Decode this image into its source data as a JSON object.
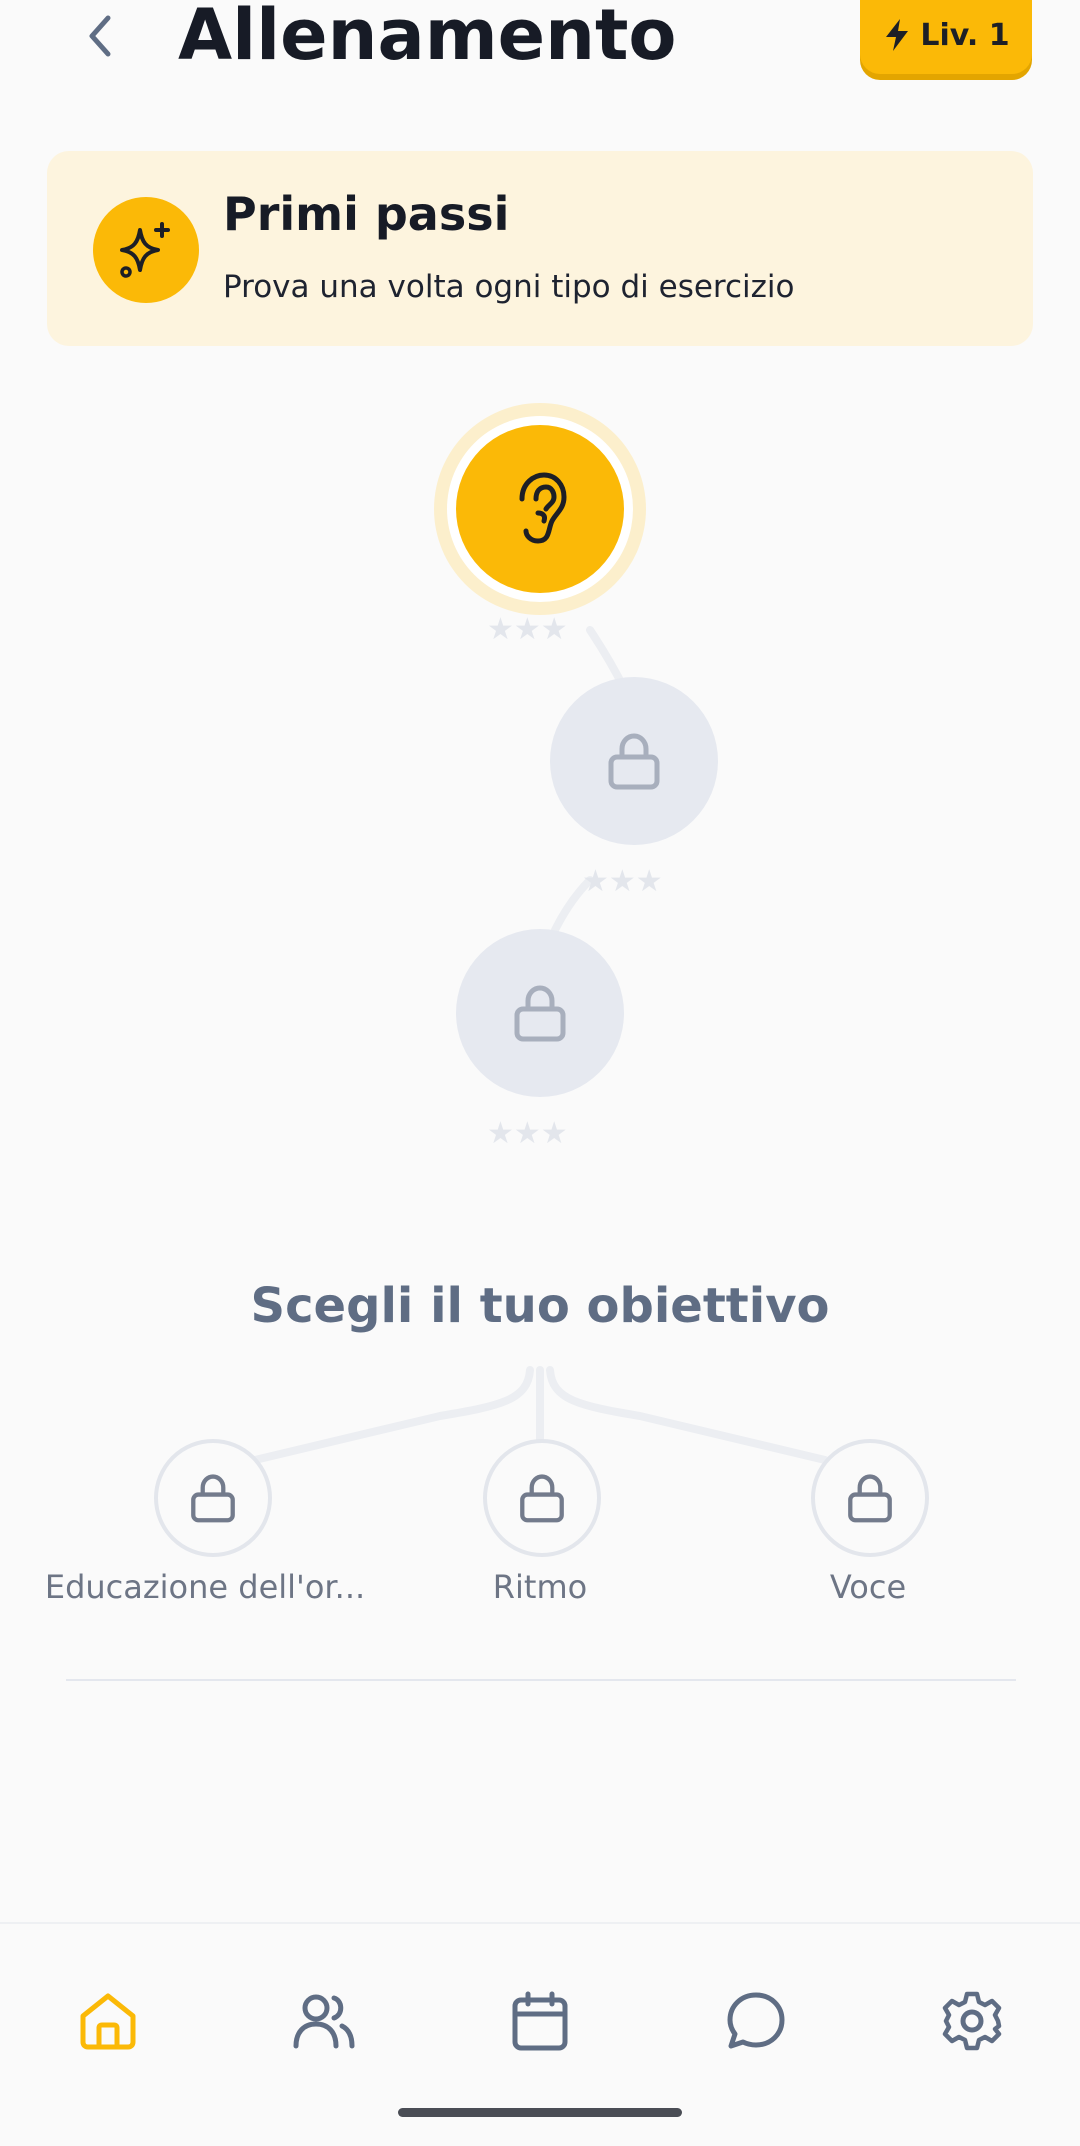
{
  "header": {
    "title": "Allenamento",
    "level_badge": "Liv. 1"
  },
  "quest": {
    "title": "Primi passi",
    "subtitle": "Prova una volta ogni tipo di esercizio"
  },
  "path": {
    "nodes": [
      {
        "state": "active",
        "icon": "ear-icon",
        "stars_earned": 0,
        "stars_total": 3
      },
      {
        "state": "locked",
        "icon": "lock-icon",
        "stars_earned": 0,
        "stars_total": 3
      },
      {
        "state": "locked",
        "icon": "lock-icon",
        "stars_earned": 0,
        "stars_total": 3
      }
    ],
    "star_glyph": "★★★"
  },
  "goals": {
    "title": "Scegli il tuo obiettivo",
    "items": [
      {
        "label": "Educazione dell'or...",
        "icon": "lock-icon"
      },
      {
        "label": "Ritmo",
        "icon": "lock-icon"
      },
      {
        "label": "Voce",
        "icon": "lock-icon"
      }
    ]
  },
  "nav": {
    "items": [
      {
        "name": "home",
        "icon": "home-icon",
        "active": true
      },
      {
        "name": "friends",
        "icon": "users-icon",
        "active": false
      },
      {
        "name": "calendar",
        "icon": "calendar-icon",
        "active": false
      },
      {
        "name": "chat",
        "icon": "chat-icon",
        "active": false
      },
      {
        "name": "settings",
        "icon": "gear-icon",
        "active": false
      }
    ]
  },
  "colors": {
    "accent": "#fbb907",
    "quest_background": "#fdf4de",
    "locked_node": "#e6e9f0",
    "muted_text": "#5f6d84"
  }
}
